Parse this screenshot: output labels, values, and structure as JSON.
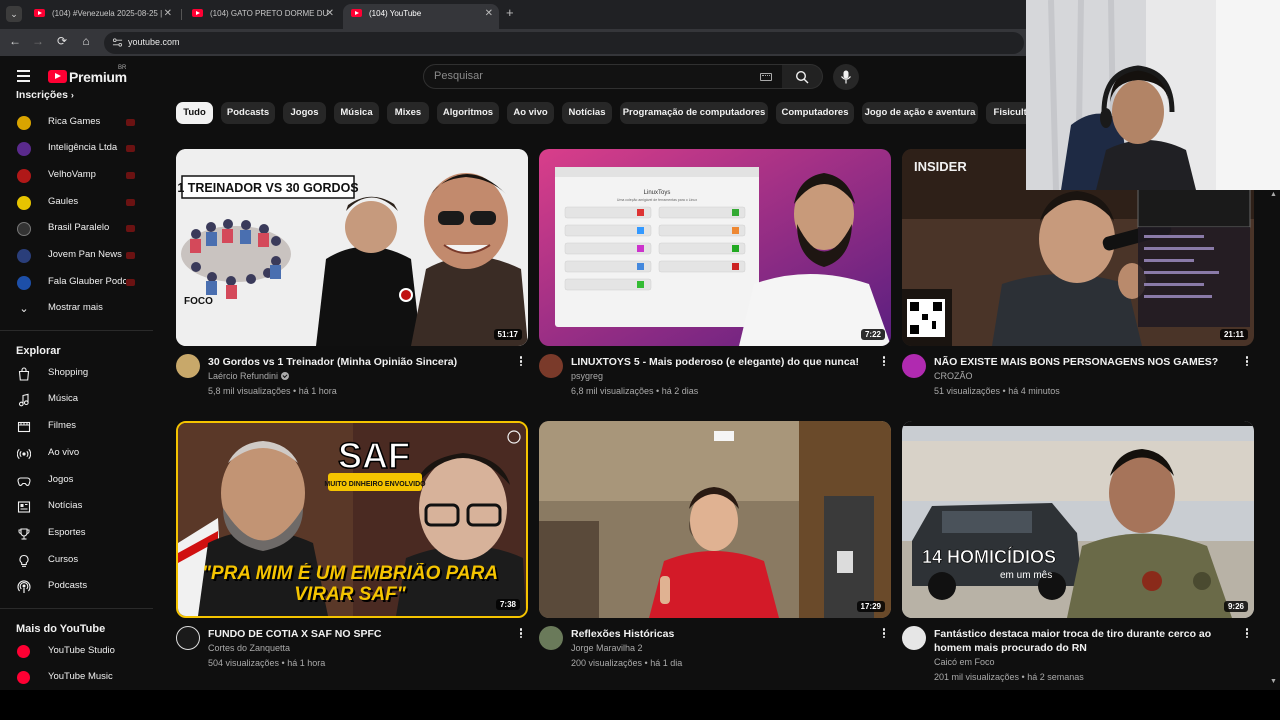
{
  "browser": {
    "tabs": [
      {
        "title": "(104) #Venezuela 2025-08-25 | ",
        "active": false
      },
      {
        "title": "(104) GATO PRETO DORME DU",
        "active": false
      },
      {
        "title": "(104) YouTube",
        "active": true
      }
    ],
    "url": "youtube.com"
  },
  "header": {
    "logo_text": "Premium",
    "region": "BR",
    "search_placeholder": "Pesquisar"
  },
  "sidebar": {
    "subscriptions_title": "Inscrições",
    "subscriptions": [
      {
        "label": "Rica Games",
        "color": "#d9a400"
      },
      {
        "label": "Inteligência Ltda",
        "color": "#5a2a8c"
      },
      {
        "label": "VelhoVamp",
        "color": "#b01818"
      },
      {
        "label": "Gaules",
        "color": "#e6c400"
      },
      {
        "label": "Brasil Paralelo",
        "color": "#333333"
      },
      {
        "label": "Jovem Pan News",
        "color": "#2a3e7a"
      },
      {
        "label": "Fala Glauber Podcast",
        "color": "#1d4fa8"
      }
    ],
    "show_more": "Mostrar mais",
    "explore_title": "Explorar",
    "explore": [
      {
        "label": "Shopping",
        "icon": "shopping-bag-icon"
      },
      {
        "label": "Música",
        "icon": "music-note-icon"
      },
      {
        "label": "Filmes",
        "icon": "film-icon"
      },
      {
        "label": "Ao vivo",
        "icon": "live-icon"
      },
      {
        "label": "Jogos",
        "icon": "gamepad-icon"
      },
      {
        "label": "Notícias",
        "icon": "news-icon"
      },
      {
        "label": "Esportes",
        "icon": "trophy-icon"
      },
      {
        "label": "Cursos",
        "icon": "lightbulb-icon"
      },
      {
        "label": "Podcasts",
        "icon": "podcast-icon"
      }
    ],
    "more_title": "Mais do YouTube",
    "more": [
      {
        "label": "YouTube Studio"
      },
      {
        "label": "YouTube Music"
      }
    ]
  },
  "chips": [
    "Tudo",
    "Podcasts",
    "Jogos",
    "Música",
    "Mixes",
    "Algoritmos",
    "Ao vivo",
    "Notícias",
    "Programação de computadores",
    "Computadores",
    "Jogo de ação e aventura",
    "Fisiculturismo"
  ],
  "videos": [
    {
      "title": "30 Gordos vs 1 Treinador (Minha Opinião Sincera)",
      "channel": "Laércio Refundini",
      "verified": true,
      "views": "5,8 mil visualizações",
      "age": "há 1 hora",
      "duration": "51:17",
      "overlay": "1 TREINADOR VS 30 GORDOS",
      "overlay2": "FOCO"
    },
    {
      "title": "LINUXTOYS 5 - Mais poderoso (e elegante) do que nunca!",
      "channel": "psygreg",
      "verified": false,
      "views": "6,8 mil visualizações",
      "age": "há 2 dias",
      "duration": "7:22",
      "overlay": "LinuxToys",
      "overlay2": "Uma coleção amigável de ferramentas para o Linux"
    },
    {
      "title": "NÃO EXISTE MAIS BONS PERSONAGENS NOS GAMES?",
      "channel": "CROZÃO",
      "verified": false,
      "views": "51 visualizações",
      "age": "há 4 minutos",
      "duration": "21:11",
      "overlay": "INSIDER",
      "overlay2": ""
    },
    {
      "title": "FUNDO DE COTIA X SAF NO SPFC",
      "channel": "Cortes do Zanquetta",
      "verified": false,
      "views": "504 visualizações",
      "age": "há 1 hora",
      "duration": "7:38",
      "overlay": "SAF",
      "overlay2": "MUITO DINHEIRO ENVOLVIDO",
      "overlay3": "\"PRA MIM É UM EMBRIÃO PARA VIRAR SAF\""
    },
    {
      "title": "Reflexões Históricas",
      "channel": "Jorge Maravilha 2",
      "verified": false,
      "views": "200 visualizações",
      "age": "há 1 dia",
      "duration": "17:29",
      "overlay": "",
      "overlay2": ""
    },
    {
      "title": "Fantástico destaca maior troca de tiro durante cerco ao homem mais procurado do RN",
      "channel": "Caicó em Foco",
      "verified": false,
      "views": "201 mil visualizações",
      "age": "há 2 semanas",
      "duration": "9:26",
      "overlay": "14 HOMICÍDIOS",
      "overlay2": "em um mês"
    }
  ]
}
